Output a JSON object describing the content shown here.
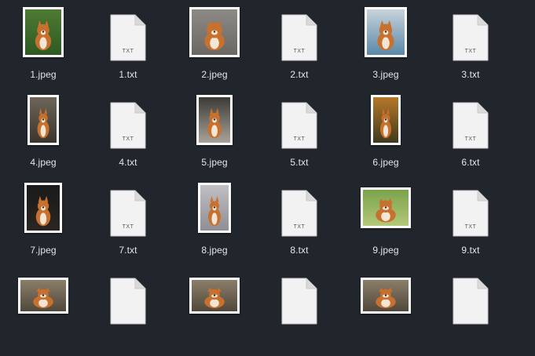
{
  "files": [
    {
      "name": "1.jpeg",
      "kind": "image",
      "scene": "shiba-grass"
    },
    {
      "name": "1.txt",
      "kind": "text",
      "badge": "TXT"
    },
    {
      "name": "2.jpeg",
      "kind": "image",
      "scene": "shiba-pavement"
    },
    {
      "name": "2.txt",
      "kind": "text",
      "badge": "TXT"
    },
    {
      "name": "3.jpeg",
      "kind": "image",
      "scene": "shiba-window"
    },
    {
      "name": "3.txt",
      "kind": "text",
      "badge": "TXT"
    },
    {
      "name": "4.jpeg",
      "kind": "image",
      "scene": "shiba-standing"
    },
    {
      "name": "4.txt",
      "kind": "text",
      "badge": "TXT"
    },
    {
      "name": "5.jpeg",
      "kind": "image",
      "scene": "shiba-sitting-light"
    },
    {
      "name": "5.txt",
      "kind": "text",
      "badge": "TXT"
    },
    {
      "name": "6.jpeg",
      "kind": "image",
      "scene": "shiba-autumn"
    },
    {
      "name": "6.txt",
      "kind": "text",
      "badge": "TXT"
    },
    {
      "name": "7.jpeg",
      "kind": "image",
      "scene": "shiba-dark"
    },
    {
      "name": "7.txt",
      "kind": "text",
      "badge": "TXT"
    },
    {
      "name": "8.jpeg",
      "kind": "image",
      "scene": "shiba-studio"
    },
    {
      "name": "8.txt",
      "kind": "text",
      "badge": "TXT"
    },
    {
      "name": "9.jpeg",
      "kind": "image",
      "scene": "shiba-running"
    },
    {
      "name": "9.txt",
      "kind": "text",
      "badge": "TXT"
    },
    {
      "name": "",
      "kind": "image",
      "scene": "shiba-partial"
    },
    {
      "name": "",
      "kind": "text",
      "badge": ""
    },
    {
      "name": "",
      "kind": "image",
      "scene": "shiba-partial"
    },
    {
      "name": "",
      "kind": "text",
      "badge": ""
    },
    {
      "name": "",
      "kind": "image",
      "scene": "shiba-partial"
    },
    {
      "name": "",
      "kind": "text",
      "badge": ""
    }
  ],
  "colors": {
    "background": "#20262c",
    "label": "#e3e6e9",
    "page": "#f2f2f2",
    "fold": "#d9d9d9",
    "badge": "#555555",
    "shiba": "#c8702e"
  },
  "icons": {
    "text_file": "document-txt-icon",
    "image_file": "image-thumbnail-icon"
  }
}
